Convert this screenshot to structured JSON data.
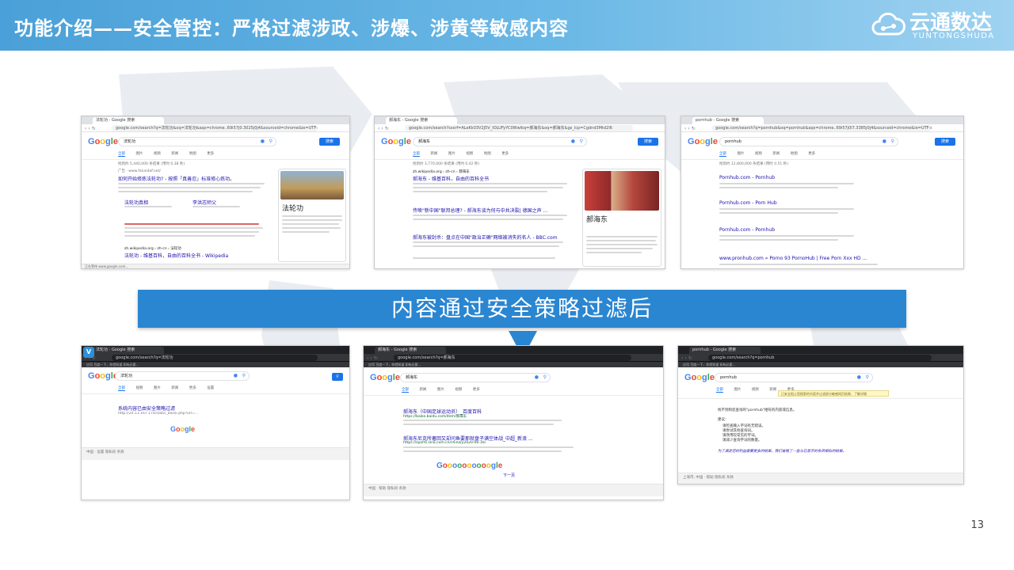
{
  "header": {
    "title": "功能介绍——安全管控：严格过滤涉政、涉爆、涉黄等敏感内容",
    "logo_cn": "云通数达",
    "logo_en": "YUNTONGSHUDA"
  },
  "band": {
    "text": "内容通过安全策略过滤后"
  },
  "page_number": "13",
  "colors": {
    "band": "#2a86d1",
    "banner_start": "#4aa0d8",
    "google_blue": "#1a73e8"
  },
  "before": [
    {
      "tab": "法轮功 - Google 搜索",
      "url": "google.com/search?q=法轮功&oq=法轮功&aqs=chrome..69i57j0.3025j0j4&sourceid=chrome&ie=UTF-8",
      "query": "法轮功",
      "search_btn": "搜索",
      "tabs": [
        "全部",
        "图片",
        "视频",
        "新闻",
        "地图",
        "更多",
        "设置",
        "工具"
      ],
      "stats": "找到约 5,440,000 条结果 (用时 0.38 秒)",
      "ad_label": "广告 · www.falundaf.net/",
      "result1": "如何开始修炼法轮功? - 按照「真善忍」标准修心炼功。",
      "sub_a": "法轮功真相",
      "sub_b": "李洪志师父",
      "result2_url": "zh.wikipedia.org › zh-cn › 法轮功",
      "result2": "法轮功 - 维基百科，自由的百科全书 - Wikipedia",
      "panel_name": "法轮功",
      "status": "正在等待 www.google.com..."
    },
    {
      "tab": "郝海东 - Google 搜索",
      "url": "google.com/search?sxsrf=ALeKk03V2J5V_IOLUFyYC0Wwlkq=郝海东&oq=郝海东&gs_lcp=Cgdnd3Mtd2l6",
      "query": "郝海东",
      "search_btn": "搜索",
      "tabs": [
        "全部",
        "新闻",
        "图片",
        "视频",
        "地图",
        "更多",
        "设置",
        "工具"
      ],
      "stats": "找到约 3,770,000 条结果 (用时 0.42 秒)",
      "result1": "郝海东 - 维基百科，自由的百科全书",
      "result1_url": "zh.wikipedia.org › zh-cn › 郝海东",
      "result2": "传唤\"新中国\"联邦总理? - 郝海东谈为何与中共决裂| 德国之声 ...",
      "result3": "郝海东被封杀：盘点在中国\"政治正确\"网络被消失的名人 - BBC.com",
      "panel_name": "郝海东"
    },
    {
      "tab": "pornhub - Google 搜索",
      "url": "google.com/search?q=pornhub&oq=pornhub&aqs=chrome..69i57j0l7.3385j0j4&sourceid=chrome&ie=UTF-8",
      "query": "pornhub",
      "search_btn": "搜索",
      "tabs": [
        "全部",
        "图片",
        "视频",
        "新闻",
        "地图",
        "更多",
        "设置",
        "工具"
      ],
      "stats": "找到约 12,800,000 条结果 (用时 0.51 秒)",
      "results": [
        "Pornhub.com - Pornhub",
        "Pornhub.com - Porn Hub",
        "Pornhub.com - Pornhub",
        "www.pronhub.com » Porno 93 PornoHub | Free Porn Xxx HD ..."
      ]
    }
  ],
  "after": [
    {
      "tab": "法轮功 - Google 搜索",
      "url": "google.com/search?q=法轮功",
      "bookmarks": "应用  百度一下，你就知道  如有必要...",
      "query": "法轮功",
      "tabs": [
        "全部",
        "视频",
        "图片",
        "新闻",
        "更多",
        "设置"
      ],
      "error_line1": "系统内容已由安全策略过滤",
      "error_line2": "http://24.11.167.174/static_block.php?url=...",
      "footer": "中国 · 设置  隐私权  条款"
    },
    {
      "tab": "郝海东 - Google 搜索",
      "url": "google.com/search?q=郝海东",
      "bookmarks": "应用  百度一下，你就知道  如有必要...",
      "query": "郝海东",
      "tabs": [
        "全部",
        "新闻",
        "图片",
        "视频",
        "更多"
      ],
      "result1": "郝海东（中国足球运动员）_百度百科",
      "result1_url": "https://baike.baidu.com/item/郝海东",
      "result2": "郝海东尼克所著回又却问鱼要那就盘子满空体战_中超_新浪 ...",
      "result2_url": "https://sports.sina.com.cn/china/j/2020-06-16/",
      "pager": "Gooooooooooogle",
      "next": "下一页",
      "footer": "中国 · 帮助  隐私权  条款"
    },
    {
      "tab": "pornhub - Google 搜索",
      "url": "google.com/search?q=pornhub",
      "bookmarks": "应用  百度一下，你就知道  如有必要...",
      "query": "pornhub",
      "tabs": [
        "全部",
        "图片",
        "视频",
        "新闻",
        "更多"
      ],
      "warning": "已安全阻止您搜索的内容并过滤部分敏感网页结果，了解详情",
      "no_result": "找不到和您查询的\"pornhub\"相符的内容或信息。",
      "tips_title": "建议：",
      "tips": [
        "请检查输入字词有无错误。",
        "请尝试其他查询词。",
        "请改用较常见的字词。",
        "请减少查询字词的数量。"
      ],
      "note": "为了满足您的利益需要更多的结果，我们省略了一些与已显示的条目相似的结果。",
      "footer": "上海市, 中国 · 帮助  隐私权  条款"
    }
  ]
}
